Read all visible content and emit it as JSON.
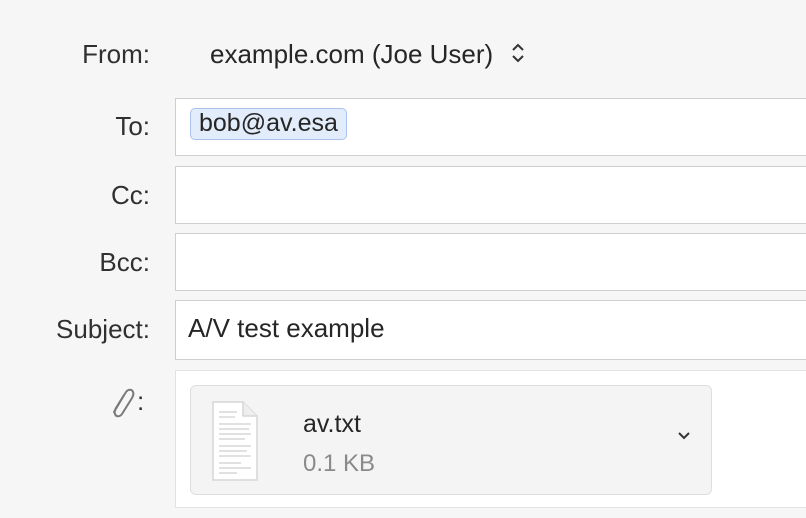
{
  "header": {
    "from_label": "From:",
    "from_value": "example.com (Joe User)",
    "to_label": "To:",
    "to_recipients": [
      "bob@av.esa"
    ],
    "cc_label": "Cc:",
    "cc_value": "",
    "bcc_label": "Bcc:",
    "bcc_value": "",
    "subject_label": "Subject:",
    "subject_value": "A/V test example",
    "attachment_colon": ":"
  },
  "attachment": {
    "name": "av.txt",
    "size": "0.1 KB"
  },
  "icons": {
    "from_selector": "updown-chevron-icon",
    "attachment": "paperclip-icon",
    "file": "text-document-icon",
    "expand": "chevron-down-icon"
  },
  "colors": {
    "token_fill": "#e3ecfa",
    "token_border": "#a9c3ee"
  }
}
